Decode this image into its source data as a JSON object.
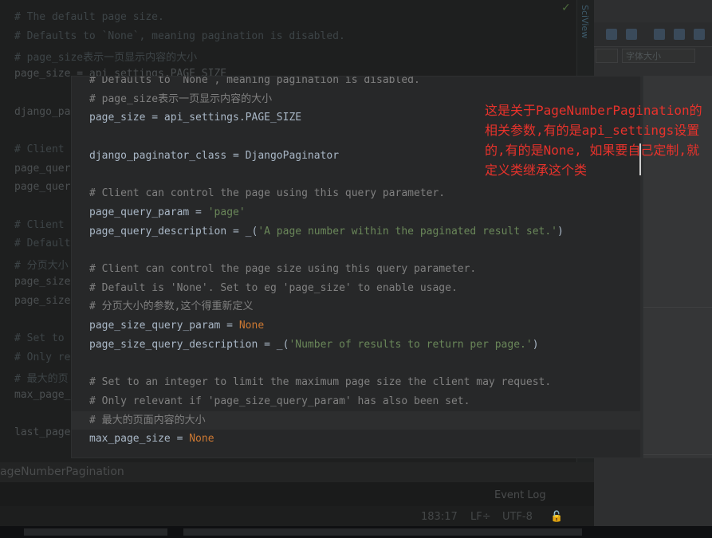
{
  "background_editor": {
    "lines": [
      "# The default page size.",
      "# Defaults to `None`, meaning pagination is disabled.",
      "# page_size表示一页显示内容的大小",
      "page_size = api_settings.PAGE_SIZE",
      "",
      "django_pa",
      "",
      "# Client",
      "page_quer",
      "page_quer",
      "",
      "# Client",
      "# Default",
      "# 分页大小",
      "page_size",
      "page_size",
      "",
      "# Set to",
      "# Only re",
      "# 最大的页",
      "max_page_",
      "",
      "last_page"
    ],
    "side_label": "SciView",
    "check_mark": "✓"
  },
  "right_panel": {
    "font_size_combo": "字体大小"
  },
  "tool_window": {
    "title": "ageNumberPagination",
    "event_log": "Event Log"
  },
  "status_bar": {
    "position": "183:17",
    "line_sep": "LF÷",
    "encoding": "UTF-8"
  },
  "popup": {
    "lines": [
      [
        {
          "t": "# Defaults to `None`, meaning pagination is disabled.",
          "c": "cm"
        }
      ],
      [
        {
          "t": "# page_size表示一页显示内容的大小",
          "c": "cm"
        }
      ],
      [
        {
          "t": "page_size = api_settings.PAGE_SIZE",
          "c": ""
        }
      ],
      [],
      [
        {
          "t": "django_paginator_class = DjangoPaginator",
          "c": ""
        }
      ],
      [],
      [
        {
          "t": "# Client can control the page using this query parameter.",
          "c": "cm"
        }
      ],
      [
        {
          "t": "page_query_param = ",
          "c": ""
        },
        {
          "t": "'page'",
          "c": "str"
        }
      ],
      [
        {
          "t": "page_query_description = _(",
          "c": ""
        },
        {
          "t": "'A page number within the paginated result set.'",
          "c": "str"
        },
        {
          "t": ")",
          "c": ""
        }
      ],
      [],
      [
        {
          "t": "# Client can control the page size using this query parameter.",
          "c": "cm"
        }
      ],
      [
        {
          "t": "# Default is 'None'. Set to eg 'page_size' to enable usage.",
          "c": "cm"
        }
      ],
      [
        {
          "t": "# 分页大小的参数,这个得重新定义",
          "c": "cm"
        }
      ],
      [
        {
          "t": "page_size_query_param = ",
          "c": ""
        },
        {
          "t": "None",
          "c": "kw"
        }
      ],
      [
        {
          "t": "page_size_query_description = _(",
          "c": ""
        },
        {
          "t": "'Number of results to return per page.'",
          "c": "str"
        },
        {
          "t": ")",
          "c": ""
        }
      ],
      [],
      [
        {
          "t": "# Set to an integer to limit the maximum page size the client may request.",
          "c": "cm"
        }
      ],
      [
        {
          "t": "# Only relevant if 'page_size_query_param' has also been set.",
          "c": "cm"
        }
      ],
      [
        {
          "t": "# 最大的页面内容的大小",
          "c": "cm"
        }
      ],
      [
        {
          "t": "max_page_size = ",
          "c": ""
        },
        {
          "t": "None",
          "c": "kw"
        }
      ]
    ]
  },
  "annotation": {
    "text": "这是关于PageNumberPagination的相关参数,有的是api_settings设置的,有的是None, 如果要自己定制,就定义类继承这个类"
  },
  "colors": {
    "comment": "#808080",
    "string": "#6a8759",
    "keyword": "#cc7832",
    "code": "#a9b7c6",
    "annotation": "#e8322b"
  }
}
